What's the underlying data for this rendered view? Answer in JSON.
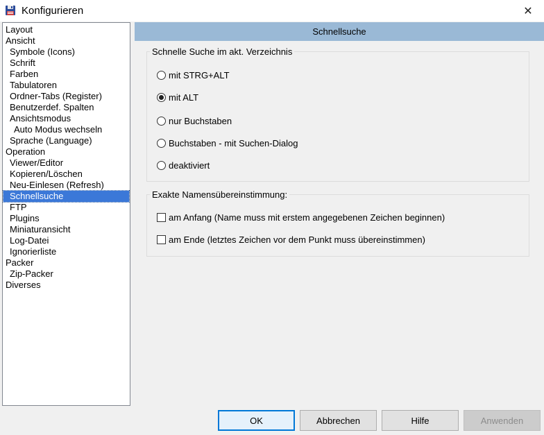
{
  "window": {
    "title": "Konfigurieren",
    "close_label": "✕"
  },
  "tree": [
    {
      "label": "Layout",
      "level": 0
    },
    {
      "label": "Ansicht",
      "level": 0
    },
    {
      "label": "Symbole (Icons)",
      "level": 1
    },
    {
      "label": "Schrift",
      "level": 1
    },
    {
      "label": "Farben",
      "level": 1
    },
    {
      "label": "Tabulatoren",
      "level": 1
    },
    {
      "label": "Ordner-Tabs (Register)",
      "level": 1
    },
    {
      "label": "Benutzerdef. Spalten",
      "level": 1
    },
    {
      "label": "Ansichtsmodus",
      "level": 1
    },
    {
      "label": "Auto Modus wechseln",
      "level": 2
    },
    {
      "label": "Sprache (Language)",
      "level": 1
    },
    {
      "label": "Operation",
      "level": 0
    },
    {
      "label": "Viewer/Editor",
      "level": 1
    },
    {
      "label": "Kopieren/Löschen",
      "level": 1
    },
    {
      "label": "Neu-Einlesen (Refresh)",
      "level": 1
    },
    {
      "label": "Schnellsuche",
      "level": 1,
      "selected": true
    },
    {
      "label": "FTP",
      "level": 1
    },
    {
      "label": "Plugins",
      "level": 1
    },
    {
      "label": "Miniaturansicht",
      "level": 1
    },
    {
      "label": "Log-Datei",
      "level": 1
    },
    {
      "label": "Ignorierliste",
      "level": 1
    },
    {
      "label": "Packer",
      "level": 0
    },
    {
      "label": "Zip-Packer",
      "level": 1
    },
    {
      "label": "Diverses",
      "level": 0
    }
  ],
  "panel": {
    "header": "Schnellsuche",
    "group1": {
      "title": "Schnelle Suche im akt. Verzeichnis",
      "options": [
        {
          "label": "mit STRG+ALT",
          "checked": false
        },
        {
          "label": "mit ALT",
          "checked": true
        },
        {
          "label": "nur Buchstaben",
          "checked": false
        },
        {
          "label": "Buchstaben - mit Suchen-Dialog",
          "checked": false
        },
        {
          "label": "deaktiviert",
          "checked": false
        }
      ]
    },
    "group2": {
      "title": "Exakte Namensübereinstimmung:",
      "checks": [
        {
          "label": "am Anfang (Name muss mit erstem angegebenen Zeichen beginnen)",
          "checked": false
        },
        {
          "label": "am Ende (letztes Zeichen vor dem Punkt muss übereinstimmen)",
          "checked": false
        }
      ]
    }
  },
  "buttons": {
    "ok": "OK",
    "cancel": "Abbrechen",
    "help": "Hilfe",
    "apply": "Anwenden"
  }
}
